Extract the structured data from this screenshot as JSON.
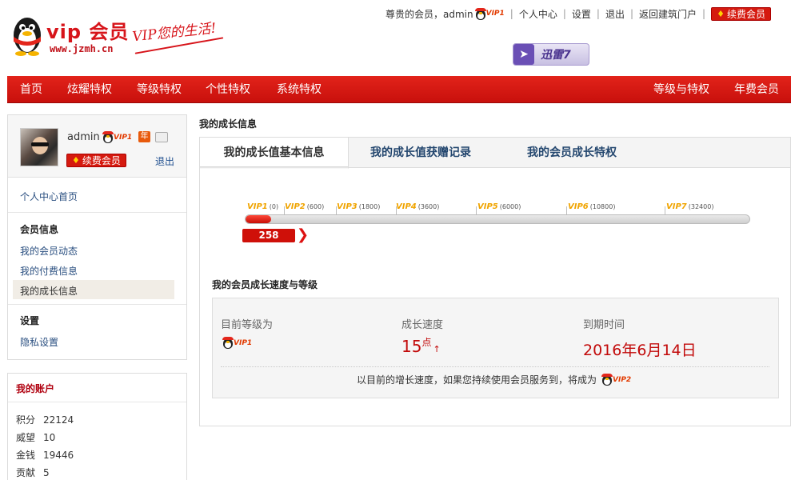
{
  "header": {
    "logo_text": "vip 会员",
    "logo_url": "www.jzmh.cn",
    "slogan": "VIP您的生活!",
    "greeting": "尊贵的会员，admin",
    "user_vip": "VIP1",
    "links": [
      "个人中心",
      "设置",
      "退出",
      "返回建筑门户"
    ],
    "renew_label": "续费会员",
    "banner": "迅雷7"
  },
  "nav": {
    "left": [
      "首页",
      "炫耀特权",
      "等级特权",
      "个性特权",
      "系统特权"
    ],
    "right": [
      "等级与特权",
      "年费会员"
    ]
  },
  "sidebar": {
    "username": "admin",
    "vip": "VIP1",
    "year_badge": "年",
    "renew_label": "续费会员",
    "logout": "退出",
    "home": "个人中心首页",
    "section_member": "会员信息",
    "member_items": [
      "我的会员动态",
      "我的付费信息",
      "我的成长信息"
    ],
    "section_settings": "设置",
    "settings_items": [
      "隐私设置"
    ]
  },
  "account": {
    "title": "我的账户",
    "rows": [
      {
        "label": "积分",
        "value": "22124"
      },
      {
        "label": "威望",
        "value": "10"
      },
      {
        "label": "金钱",
        "value": "19446"
      },
      {
        "label": "贡献",
        "value": "5"
      }
    ]
  },
  "main": {
    "page_title": "我的成长信息",
    "tabs": [
      "我的成长值基本信息",
      "我的成长值获赠记录",
      "我的会员成长特权"
    ],
    "levels": [
      {
        "name": "VIP1",
        "points": "(0)"
      },
      {
        "name": "VIP2",
        "points": "(600)"
      },
      {
        "name": "VIP3",
        "points": "(1800)"
      },
      {
        "name": "VIP4",
        "points": "(3600)"
      },
      {
        "name": "VIP5",
        "points": "(6000)"
      },
      {
        "name": "VIP6",
        "points": "(10800)"
      },
      {
        "name": "VIP7",
        "points": "(32400)"
      }
    ],
    "current_score": "258",
    "progress_fraction": 0.05,
    "sub_title": "我的会员成长速度与等级",
    "current_level_label": "目前等级为",
    "current_level": "VIP1",
    "speed_label": "成长速度",
    "speed_value": "15",
    "speed_unit": "点",
    "speed_arrow": "↑",
    "expiry_label": "到期时间",
    "expiry_value": "2016年6月14日",
    "future_text": "以目前的增长速度，如果您持续使用会员服务到，将成为",
    "future_level": "VIP2"
  },
  "colors": {
    "brand_red": "#d7141a",
    "nav_red": "#d41a12",
    "link_blue": "#2a4f80",
    "vip_gold": "#f0a400"
  }
}
